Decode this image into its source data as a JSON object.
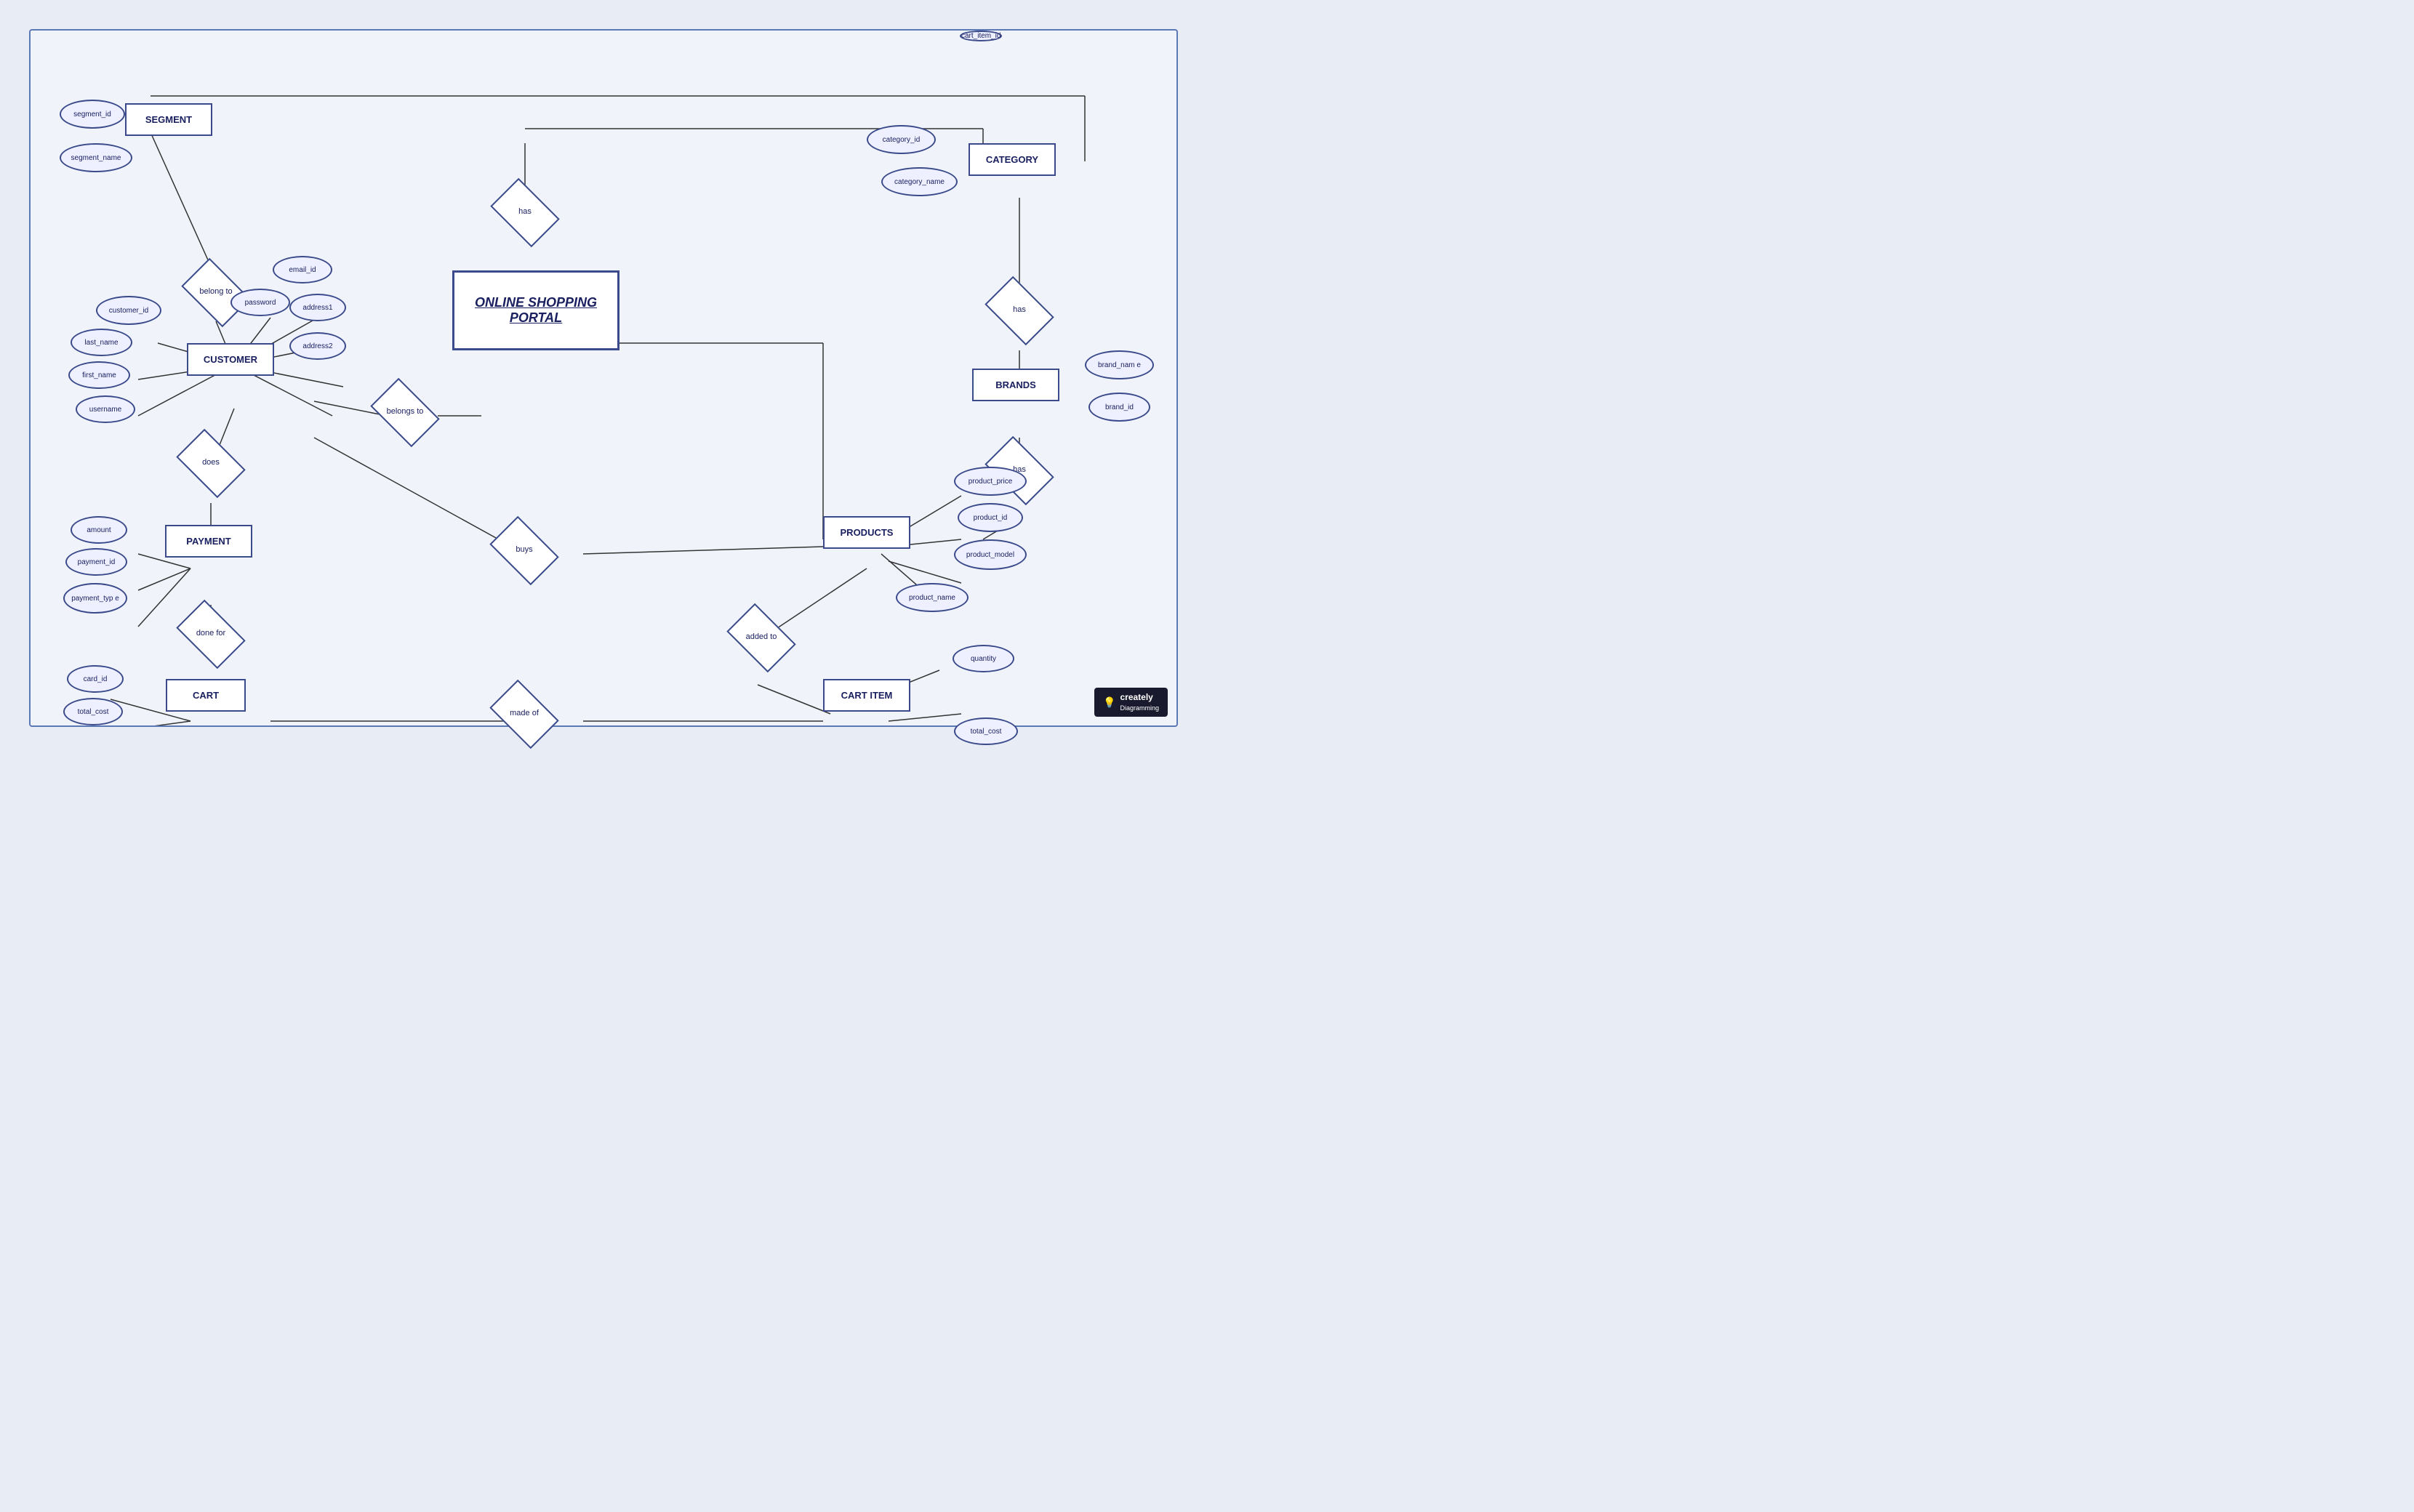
{
  "title": "ONLINE SHOPPING PORTAL",
  "entities": {
    "segment": {
      "label": "SEGMENT"
    },
    "customer": {
      "label": "CUSTOMER"
    },
    "payment": {
      "label": "PAYMENT"
    },
    "cart": {
      "label": "CART"
    },
    "category": {
      "label": "CATEGORY"
    },
    "brands": {
      "label": "BRANDS"
    },
    "products": {
      "label": "PRODUCTS"
    },
    "cart_item": {
      "label": "CART ITEM"
    }
  },
  "attributes": {
    "segment_id": "segment_id",
    "segment_name": "segment_name",
    "customer_id": "customer_id",
    "last_name": "last_name",
    "first_name": "first_name",
    "username": "username",
    "password": "password",
    "email_id": "email_id",
    "address1": "address1",
    "address2": "address2",
    "amount": "amount",
    "payment_id": "payment_id",
    "payment_type": "payment_typ e",
    "card_id": "card_id",
    "total_cost_cart": "total_cost",
    "category_id": "category_id",
    "category_name": "category_name",
    "brand_name": "brand_nam e",
    "brand_id": "brand_id",
    "product_price": "product_price",
    "product_id": "product_id",
    "product_model": "product_model",
    "product_name": "product_name",
    "quantity": "quantity",
    "cart_item_id": "cart_item_id",
    "total_cost_ci": "total_cost"
  },
  "relationships": {
    "belong_to": "belong to",
    "belongs_to": "belongs to",
    "has_cat": "has",
    "has_brands": "has",
    "has_products": "has",
    "does": "does",
    "done_for": "done for",
    "buys": "buys",
    "added_to": "added to",
    "made_of": "made of"
  },
  "badge": {
    "icon": "💡",
    "brand": "creately",
    "sub": "Diagramming"
  }
}
